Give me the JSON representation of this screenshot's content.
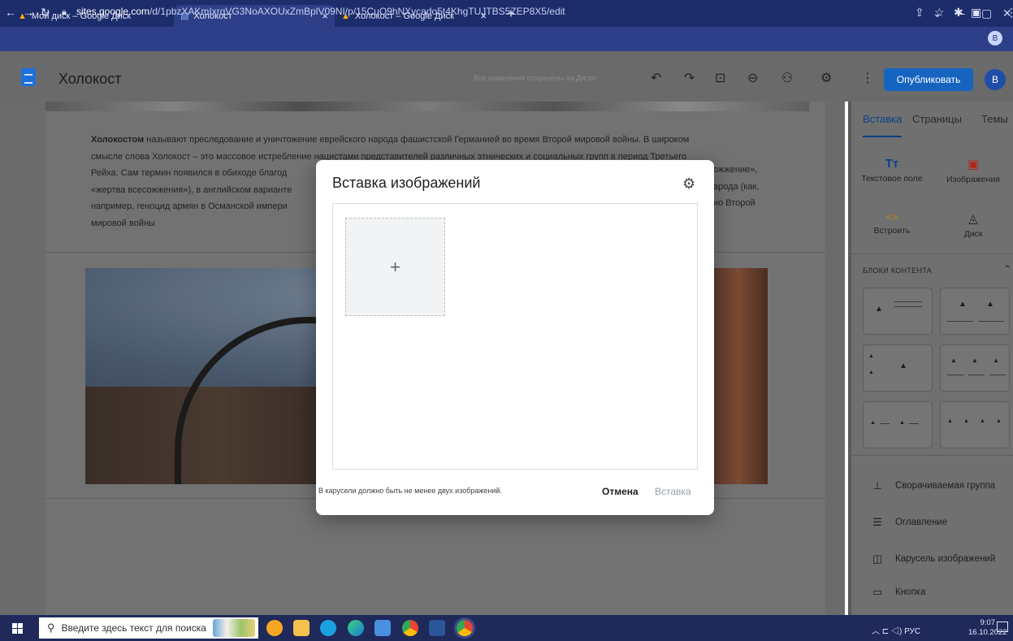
{
  "browser": {
    "tabs": [
      {
        "label": "Мой диск – Google Диск",
        "icon": "google-drive-icon"
      },
      {
        "label": "Холокост",
        "icon": "google-sites-icon"
      },
      {
        "label": "Холокост – Google Диск",
        "icon": "google-drive-icon"
      }
    ],
    "new_tab": "+",
    "url_domain": "sites.google.com",
    "url_path": "/d/1pbzXAKmIxrqVG3NoAXOUxZmBplV09NI/p/15CuO9hNXycado5t4KhgTUJTBS5ZEP8X5/edit",
    "profile_initial": "B"
  },
  "header": {
    "title": "Холокост",
    "saved_status": "Все изменения сохранены на Диске",
    "publish_label": "Опубликовать",
    "avatar_initial": "В"
  },
  "page": {
    "paragraph_bold": "Холокостом",
    "paragraph_lines": [
      " называют преследование и уничтожение еврейского народа фашистской Германией во время Второй мировой войны. В широком",
      "смысле слова Холокост – это массовое истребление нацистами представителей различных этнических и социальных групп в период Третьего",
      "Рейха. Сам термин появился в обиходе благод",
      "«жертва всесожжения»), в английском варианте",
      "например, геноцид армян в Османской импери",
      "мировой войны"
    ],
    "paragraph_right_fragments": [
      "ожжение»,",
      "арода (как,",
      "но Второй"
    ]
  },
  "right_panel": {
    "tabs": [
      "Вставка",
      "Страницы",
      "Темы"
    ],
    "tools": [
      {
        "label": "Текстовое поле",
        "icon": "text-box-icon",
        "glyph": "Tт"
      },
      {
        "label": "Изображения",
        "icon": "image-icon",
        "glyph": "▣"
      },
      {
        "label": "Встроить",
        "icon": "embed-icon",
        "glyph": "<>"
      },
      {
        "label": "Диск",
        "icon": "google-drive-icon",
        "glyph": "◬"
      }
    ],
    "blocks_title": "БЛОКИ КОНТЕНТА",
    "items": [
      {
        "label": "Сворачиваемая группа",
        "icon": "collapsible-group-icon",
        "glyph": "⊥"
      },
      {
        "label": "Оглавление",
        "icon": "table-of-contents-icon",
        "glyph": "☰"
      },
      {
        "label": "Карусель изображений",
        "icon": "image-carousel-icon",
        "glyph": "◫"
      },
      {
        "label": "Кнопка",
        "icon": "button-icon",
        "glyph": "▭"
      }
    ]
  },
  "modal": {
    "title": "Вставка изображений",
    "add_glyph": "+",
    "note": "В карусели должно быть не менее двух изображений.",
    "cancel_label": "Отмена",
    "insert_label": "Вставка"
  },
  "taskbar": {
    "search_placeholder": "Введите здесь текст для поиска",
    "language": "РУС",
    "time": "9:07",
    "date": "16.10.2022"
  },
  "colors": {
    "tabbar": "#1d2c6b",
    "addressbar": "#2d3f86",
    "publish": "#1565c0",
    "accent": "#0d3f8a",
    "taskbar": "#1f2a5a"
  }
}
